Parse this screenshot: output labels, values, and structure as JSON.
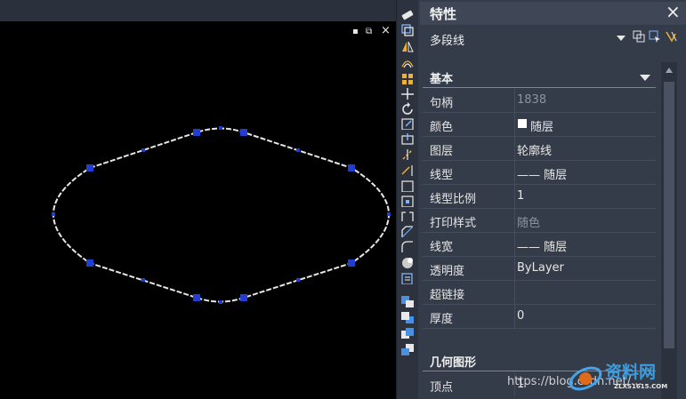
{
  "canvas": {
    "window_controls": {
      "minimize": "▪",
      "restore": "⧉",
      "close": "×"
    },
    "colors": {
      "shape_outline": "#e6e6e6",
      "grip": "#1e3fd0"
    }
  },
  "toolbar": {
    "tools": [
      "eraser-icon",
      "copy-icon",
      "mirror-icon",
      "offset-icon",
      "array-icon",
      "move-icon",
      "rotate-icon",
      "scale-icon",
      "stretch-icon",
      "trim-icon",
      "extend-icon",
      "break-icon",
      "break-at-point-icon",
      "join-icon",
      "chamfer-icon",
      "fillet-icon",
      "blend-icon",
      "explode-icon",
      "properties-icon",
      "draworder-front-icon",
      "draworder-back-icon",
      "draworder-above-icon",
      "draworder-under-icon"
    ]
  },
  "panel": {
    "title": "特性",
    "close_label": "×",
    "object_type": "多段线",
    "sections": {
      "basic": "基本",
      "geometry": "几何图形"
    },
    "rows": [
      {
        "key": "句柄",
        "value": "1838",
        "dim": true
      },
      {
        "key": "颜色",
        "value": "随层",
        "swatch": true
      },
      {
        "key": "图层",
        "value": "轮廓线"
      },
      {
        "key": "线型",
        "value": "—— 随层"
      },
      {
        "key": "线型比例",
        "value": "1"
      },
      {
        "key": "打印样式",
        "value": "随色",
        "dim": true
      },
      {
        "key": "线宽",
        "value": "—— 随层"
      },
      {
        "key": "透明度",
        "value": "ByLayer"
      },
      {
        "key": "超链接",
        "value": ""
      },
      {
        "key": "厚度",
        "value": "0"
      }
    ],
    "geometry_rows": [
      {
        "key": "顶点",
        "value": "1"
      }
    ],
    "watermark": {
      "url": "https://blog.csdn.net/...",
      "site_cn": "资料网",
      "site_en": "ZLXS1615.COM"
    }
  }
}
